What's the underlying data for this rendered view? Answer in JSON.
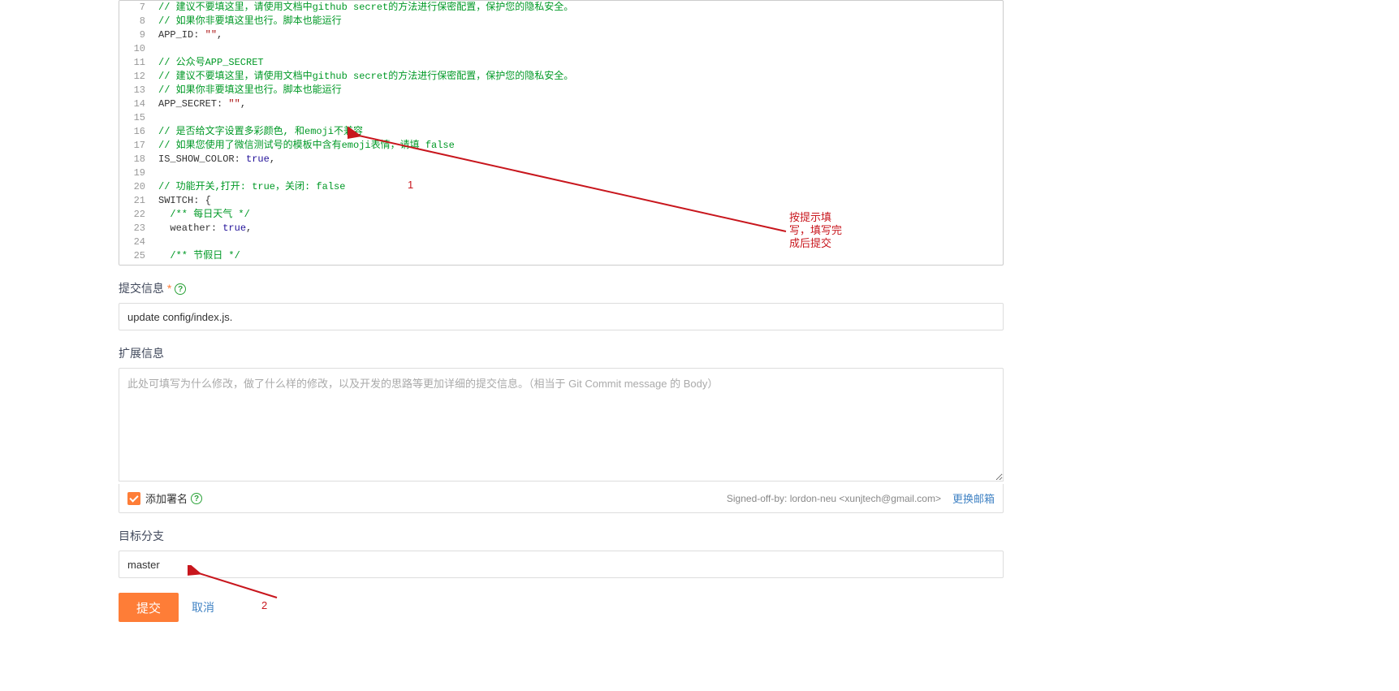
{
  "code": {
    "startLine": 7,
    "lines": [
      [
        {
          "cls": "cm-comment",
          "t": "// 建议不要填这里，请使用文档中github secret的方法进行保密配置，保护您的隐私安全。"
        }
      ],
      [
        {
          "cls": "cm-comment",
          "t": "// 如果你非要填这里也行。脚本也能运行"
        }
      ],
      [
        {
          "cls": "cm-property",
          "t": "APP_ID"
        },
        {
          "cls": "",
          "t": ": "
        },
        {
          "cls": "cm-string",
          "t": "\"\""
        },
        {
          "cls": "",
          "t": ","
        }
      ],
      [],
      [
        {
          "cls": "cm-comment",
          "t": "// 公众号APP_SECRET"
        }
      ],
      [
        {
          "cls": "cm-comment",
          "t": "// 建议不要填这里，请使用文档中github secret的方法进行保密配置，保护您的隐私安全。"
        }
      ],
      [
        {
          "cls": "cm-comment",
          "t": "// 如果你非要填这里也行。脚本也能运行"
        }
      ],
      [
        {
          "cls": "cm-property",
          "t": "APP_SECRET"
        },
        {
          "cls": "",
          "t": ": "
        },
        {
          "cls": "cm-string",
          "t": "\"\""
        },
        {
          "cls": "",
          "t": ","
        }
      ],
      [],
      [
        {
          "cls": "cm-comment",
          "t": "// 是否给文字设置多彩颜色, 和emoji不兼容"
        }
      ],
      [
        {
          "cls": "cm-comment",
          "t": "// 如果您使用了微信测试号的模板中含有emoji表情，请填 false"
        }
      ],
      [
        {
          "cls": "cm-property",
          "t": "IS_SHOW_COLOR"
        },
        {
          "cls": "",
          "t": ": "
        },
        {
          "cls": "cm-atom",
          "t": "true"
        },
        {
          "cls": "",
          "t": ","
        }
      ],
      [],
      [
        {
          "cls": "cm-comment",
          "t": "// 功能开关,打开: true，关闭: false"
        }
      ],
      [
        {
          "cls": "cm-property",
          "t": "SWITCH"
        },
        {
          "cls": "",
          "t": ": {"
        }
      ],
      [
        {
          "cls": "",
          "t": "  "
        },
        {
          "cls": "cm-comment",
          "t": "/** 每日天气 */"
        }
      ],
      [
        {
          "cls": "",
          "t": "  "
        },
        {
          "cls": "cm-property",
          "t": "weather"
        },
        {
          "cls": "",
          "t": ": "
        },
        {
          "cls": "cm-atom",
          "t": "true"
        },
        {
          "cls": "",
          "t": ","
        }
      ],
      [],
      [
        {
          "cls": "",
          "t": "  "
        },
        {
          "cls": "cm-comment",
          "t": "/** 节假日 */"
        }
      ]
    ]
  },
  "form": {
    "commitLabel": "提交信息",
    "commitValue": "update config/index.js.",
    "extendLabel": "扩展信息",
    "extendPlaceholder": "此处可填写为什么修改，做了什么样的修改，以及开发的思路等更加详细的提交信息。（相当于 Git Commit message 的 Body）",
    "addSignature": "添加署名",
    "signedOff": "Signed-off-by: lordon-neu <xunjtech@gmail.com>",
    "changeEmail": "更换邮箱",
    "branchLabel": "目标分支",
    "branchValue": "master",
    "submit": "提交",
    "cancel": "取消"
  },
  "annotations": {
    "tip": "按提示填写，填写完成后提交",
    "num1": "1",
    "num2": "2"
  }
}
